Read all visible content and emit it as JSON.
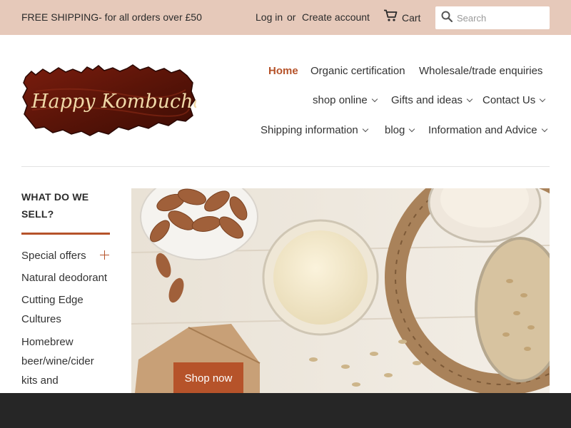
{
  "topbar": {
    "promo": "FREE SHIPPING- for all orders over £50",
    "login": "Log in",
    "or": "or",
    "create_account": "Create account",
    "cart": "Cart",
    "search_placeholder": "Search"
  },
  "logo": {
    "text": "Happy Kombucha",
    "alt": "Happy Kombucha"
  },
  "nav": {
    "home": "Home",
    "organic": "Organic certification",
    "wholesale": "Wholesale/trade enquiries",
    "shop_online": "shop online",
    "gifts": "Gifts and ideas",
    "contact": "Contact Us",
    "shipping": "Shipping information",
    "blog": "blog",
    "info": "Information and Advice"
  },
  "sidebar": {
    "heading_line1": "WHAT DO WE",
    "heading_line2": "SELL?",
    "items": [
      {
        "label": "Special offers"
      },
      {
        "label": "Natural deodorant"
      },
      {
        "label_line1": "Cutting Edge",
        "label_line2": "Cultures"
      },
      {
        "label_line1": "Homebrew",
        "label_line2": "beer/wine/cider",
        "label_line3": "kits and"
      }
    ]
  },
  "hero": {
    "button": "Shop now"
  },
  "colors": {
    "accent": "#b6532a",
    "topbar": "#e6c9ba",
    "footer": "#262626"
  }
}
